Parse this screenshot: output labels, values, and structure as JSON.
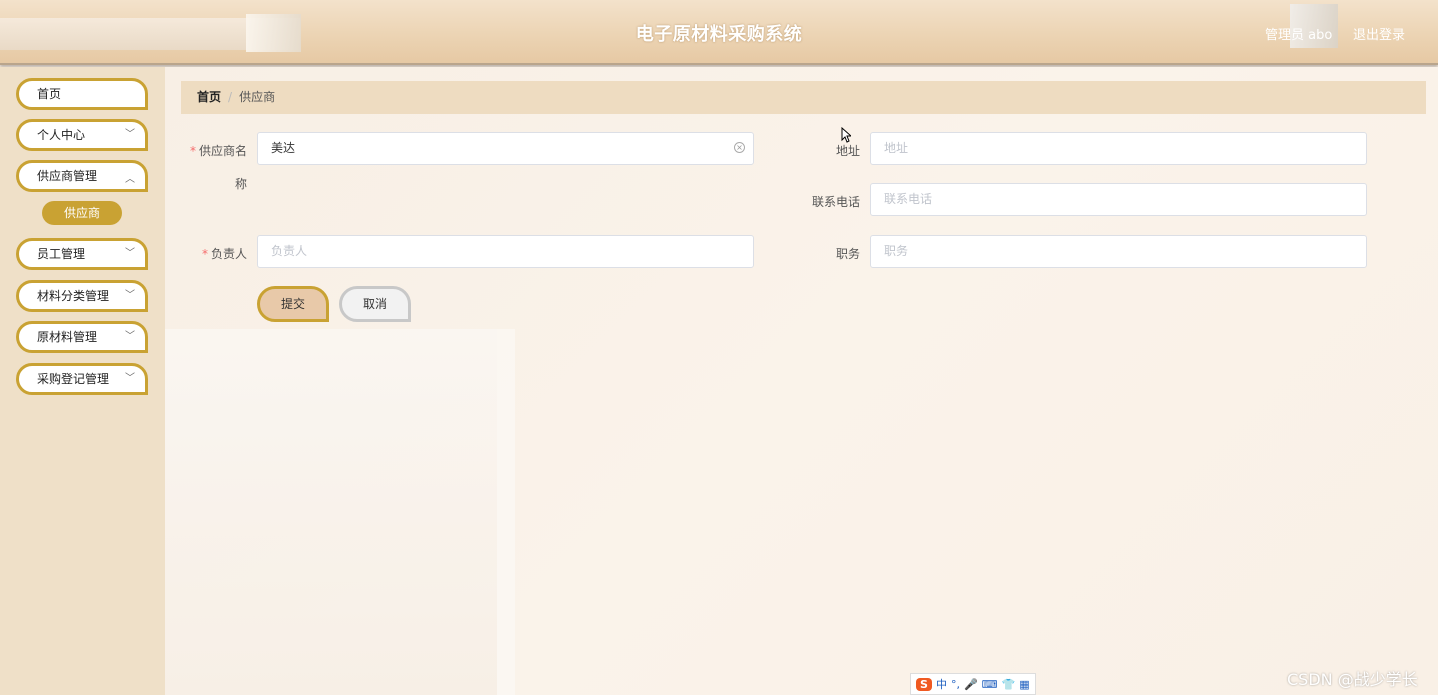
{
  "header": {
    "title": "电子原材料采购系统",
    "user_label": "管理员 abo",
    "logout_label": "退出登录"
  },
  "sidebar": {
    "items": [
      {
        "label": "首页",
        "expandable": false
      },
      {
        "label": "个人中心",
        "expandable": true
      },
      {
        "label": "供应商管理",
        "expandable": true
      },
      {
        "label": "员工管理",
        "expandable": true
      },
      {
        "label": "材料分类管理",
        "expandable": true
      },
      {
        "label": "原材料管理",
        "expandable": true
      },
      {
        "label": "采购登记管理",
        "expandable": true
      }
    ],
    "active_sub_item": "供应商",
    "chevron": "﹀"
  },
  "breadcrumb": {
    "home": "首页",
    "separator": "/",
    "current": "供应商"
  },
  "form": {
    "supplier_name": {
      "label_line1": "供应商名",
      "label_line2": "称",
      "value": "美达",
      "required": true
    },
    "address": {
      "label": "地址",
      "placeholder": "地址"
    },
    "phone": {
      "label": "联系电话",
      "placeholder": "联系电话"
    },
    "contact_person": {
      "label": "负责人",
      "placeholder": "负责人",
      "required": true
    },
    "position": {
      "label": "职务",
      "placeholder": "职务"
    },
    "required_mark": "*",
    "clear_glyph": "×",
    "submit_label": "提交",
    "cancel_label": "取消"
  },
  "ime": {
    "logo": "S",
    "items": [
      "中",
      "°,",
      "🎤",
      "⌨",
      "👕",
      "▦"
    ]
  },
  "watermark": "CSDN @战少学长",
  "colors": {
    "accent": "#c9a233",
    "sidebar_bg": "#efe0c8",
    "breadcrumb_bg": "#eedcc1",
    "submit_bg": "#e8c9a9"
  }
}
